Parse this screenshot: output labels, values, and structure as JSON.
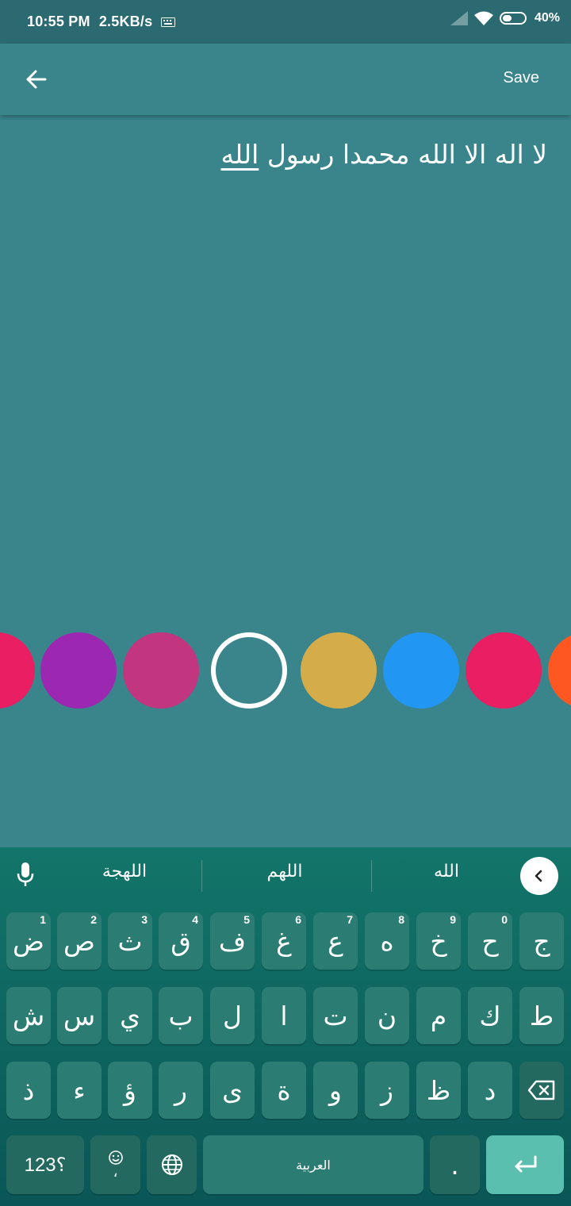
{
  "status": {
    "time": "10:55 PM",
    "speed": "2.5KB/s",
    "battery": "40%"
  },
  "toolbar": {
    "back_icon": "arrow-left-icon",
    "save_label": "Save"
  },
  "editor": {
    "text_main": "لا اله الا الله محمدا رسول ",
    "text_underlined": "الله"
  },
  "palette": {
    "colors": [
      "#e91e63",
      "#9c27b0",
      "#c2357f",
      "selected",
      "#d4ad4a",
      "#2196f3",
      "#e91e63",
      "#ff5722"
    ]
  },
  "keyboard": {
    "suggestions": [
      "اللهجة",
      "اللهم",
      "الله"
    ],
    "row1": [
      {
        "char": "ض",
        "num": "1"
      },
      {
        "char": "ص",
        "num": "2"
      },
      {
        "char": "ث",
        "num": "3"
      },
      {
        "char": "ق",
        "num": "4"
      },
      {
        "char": "ف",
        "num": "5"
      },
      {
        "char": "غ",
        "num": "6"
      },
      {
        "char": "ع",
        "num": "7"
      },
      {
        "char": "ه",
        "num": "8"
      },
      {
        "char": "خ",
        "num": "9"
      },
      {
        "char": "ح",
        "num": "0"
      },
      {
        "char": "ج",
        "num": ""
      }
    ],
    "row2": [
      "ش",
      "س",
      "ي",
      "ب",
      "ل",
      "ا",
      "ت",
      "ن",
      "م",
      "ك",
      "ط"
    ],
    "row3": [
      "ذ",
      "ء",
      "ؤ",
      "ر",
      "ى",
      "ة",
      "و",
      "ز",
      "ظ",
      "د"
    ],
    "symbols_label": "؟123",
    "emoji_comma": "،",
    "space_label": "العربية",
    "period": "."
  }
}
